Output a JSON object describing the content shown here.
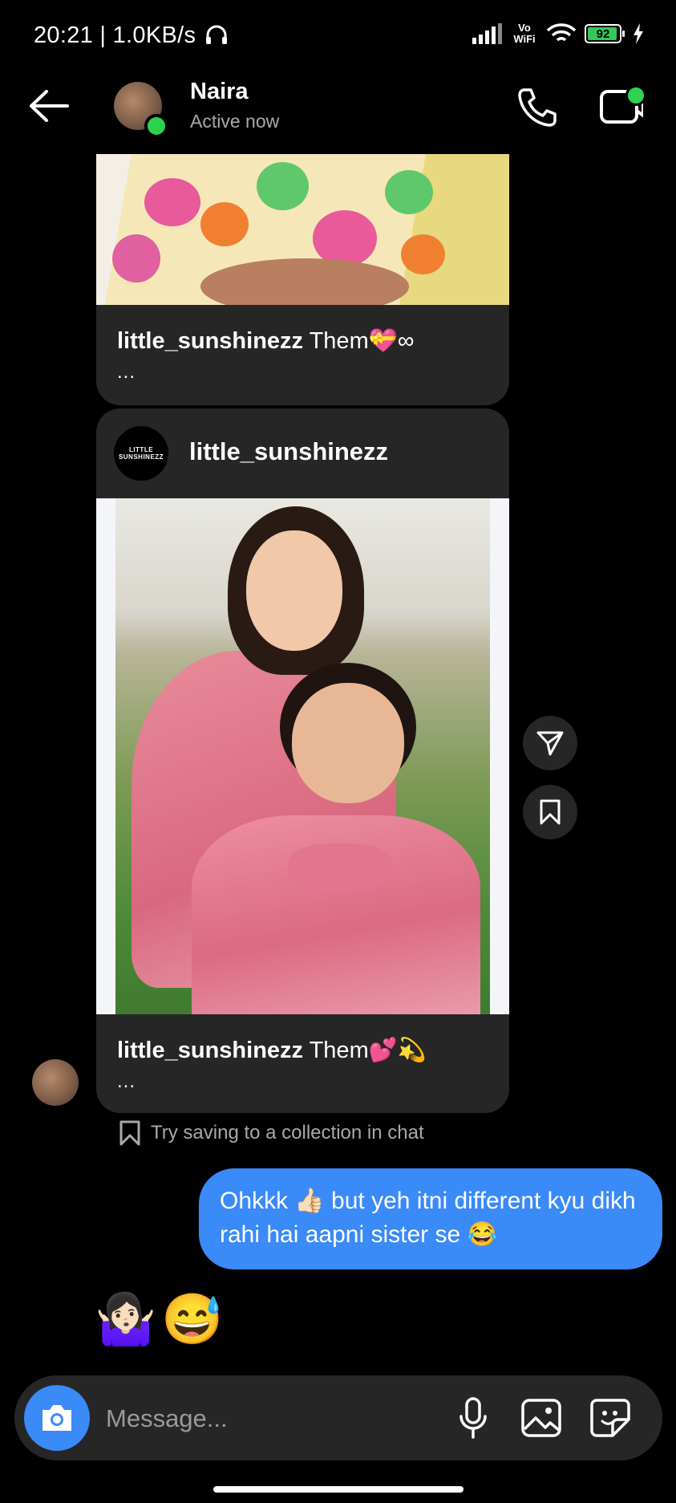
{
  "status_bar": {
    "time": "20:21 | 1.0KB/s",
    "network": "Vo WiFi",
    "battery": "92"
  },
  "header": {
    "name": "Naira",
    "status": "Active now"
  },
  "messages": {
    "card1": {
      "username": "little_sunshinezz",
      "caption": "Them💝∞",
      "more": "..."
    },
    "card2": {
      "account_logo_text": "LITTLE SUNSHINEZZ",
      "username": "little_sunshinezz",
      "caption": "Them💕💫",
      "more": "..."
    },
    "hint": "Try saving to a collection in chat",
    "outgoing": "Ohkkk 👍🏻 but yeh itni different kyu dikh rahi hai aapni sister se 😂",
    "reaction": "🤷🏻‍♀️😅"
  },
  "composer": {
    "placeholder": "Message..."
  },
  "colors": {
    "accent": "#3a8af8",
    "online": "#2dd34e",
    "card": "#262626"
  },
  "icons": [
    "back-arrow-icon",
    "phone-icon",
    "video-call-icon",
    "share-icon",
    "bookmark-icon",
    "camera-icon",
    "mic-icon",
    "gallery-icon",
    "sticker-icon",
    "headphones-icon",
    "signal-icon",
    "wifi-icon",
    "battery-icon",
    "charging-icon"
  ]
}
